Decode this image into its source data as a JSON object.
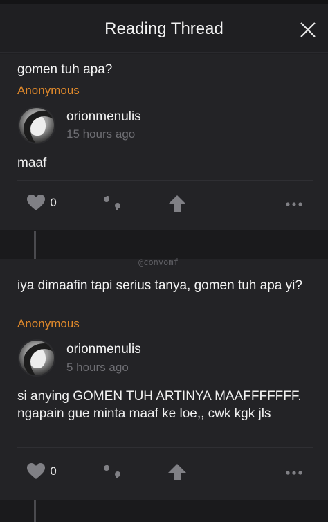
{
  "header": {
    "title": "Reading Thread"
  },
  "watermark": "@convomf",
  "posts": [
    {
      "question": "gomen tuh apa?",
      "asker": "Anonymous",
      "username": "orionmenulis",
      "time": "15 hours ago",
      "answer": "maaf",
      "likes": "0"
    },
    {
      "question": "iya dimaafin tapi serius tanya, gomen tuh apa yi?",
      "asker": "Anonymous",
      "username": "orionmenulis",
      "time": "5 hours ago",
      "answer": "si anying GOMEN TUH ARTINYA MAAFFFFFFF. ngapain gue minta maaf ke loe,, cwk kgk jls",
      "likes": "0"
    }
  ],
  "icons": {
    "close": "close-icon",
    "like": "heart-icon",
    "quote": "quote-icon",
    "upvote": "upvote-arrow-icon",
    "more": "more-dots-icon"
  },
  "colors": {
    "asker": "#e0892b",
    "background": "#1f1f22",
    "card": "#232326"
  }
}
